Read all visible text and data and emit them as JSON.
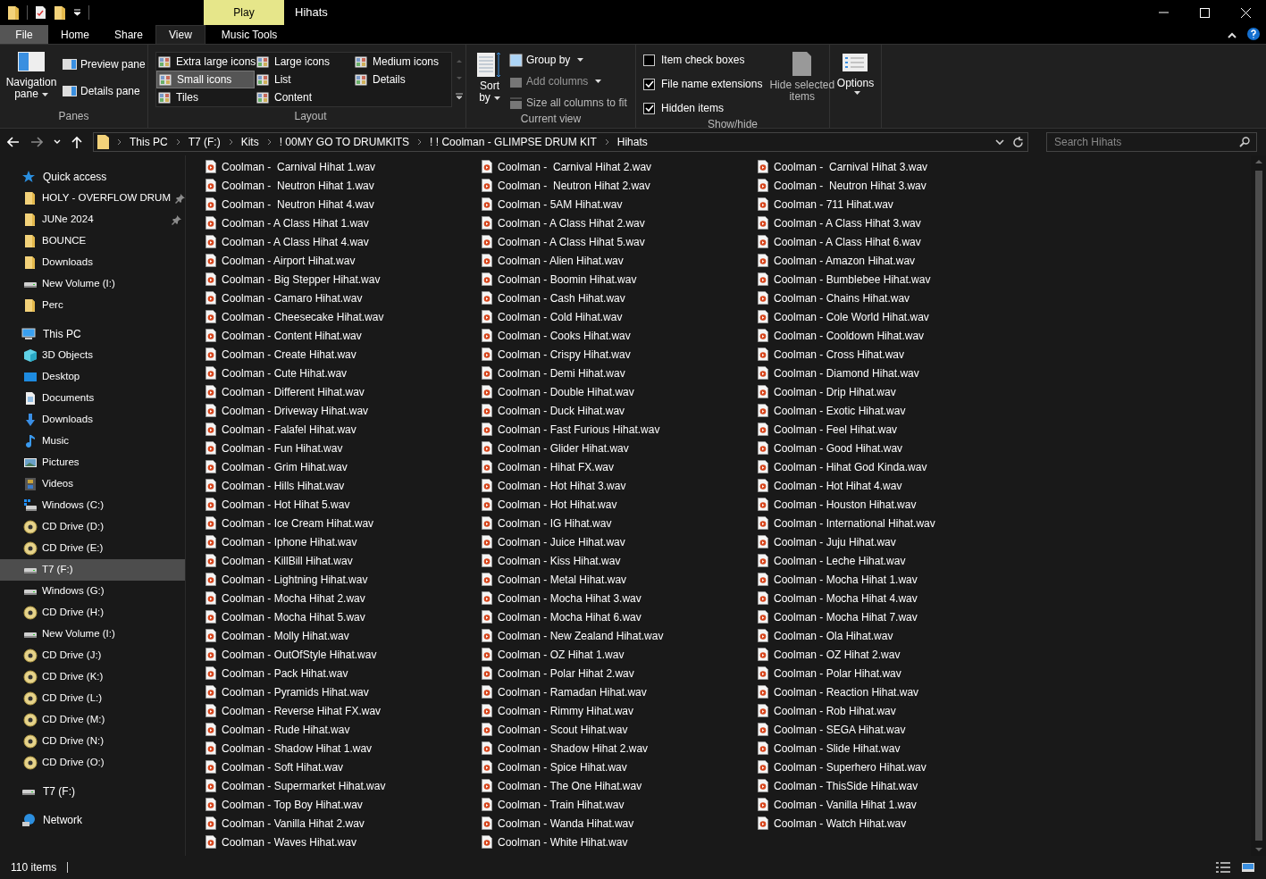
{
  "window": {
    "title": "Hihats",
    "context_tab": "Play"
  },
  "ribbon_tabs": [
    {
      "label": "File",
      "kind": "file",
      "selected": false
    },
    {
      "label": "Home",
      "kind": "tab",
      "selected": false
    },
    {
      "label": "Share",
      "kind": "tab",
      "selected": false
    },
    {
      "label": "View",
      "kind": "tab",
      "selected": true
    },
    {
      "label": "Music Tools",
      "kind": "tab",
      "selected": false
    }
  ],
  "panes": {
    "navigation": "Navigation",
    "navigation_2": "pane",
    "preview": "Preview pane",
    "details": "Details pane",
    "group": "Panes"
  },
  "layout": {
    "items": [
      {
        "label": "Extra large icons",
        "selected": false
      },
      {
        "label": "Large icons",
        "selected": false
      },
      {
        "label": "Medium icons",
        "selected": false
      },
      {
        "label": "Small icons",
        "selected": true
      },
      {
        "label": "List",
        "selected": false
      },
      {
        "label": "Details",
        "selected": false
      },
      {
        "label": "Tiles",
        "selected": false
      },
      {
        "label": "Content",
        "selected": false
      }
    ],
    "group": "Layout"
  },
  "current_view": {
    "sort": "Sort",
    "sort_2": "by",
    "group_by": "Group by",
    "add_columns": "Add columns",
    "size_columns": "Size all columns to fit",
    "group": "Current view"
  },
  "show_hide": {
    "checkboxes": [
      {
        "label": "Item check boxes",
        "checked": false
      },
      {
        "label": "File name extensions",
        "checked": true
      },
      {
        "label": "Hidden items",
        "checked": true
      }
    ],
    "hide_selected": "Hide selected",
    "hide_selected_2": "items",
    "group": "Show/hide"
  },
  "options": {
    "label": "Options"
  },
  "address": {
    "crumbs": [
      "This PC",
      "T7 (F:)",
      "Kits",
      "! 00MY GO TO DRUMKITS",
      "! ! Coolman - GLIMPSE DRUM KIT",
      "Hihats"
    ]
  },
  "search": {
    "placeholder": "Search Hihats"
  },
  "sidebar": [
    {
      "label": "Quick access",
      "kind": "star",
      "selected": false,
      "children": [
        {
          "label": "HOLY - OVERFLOW DRUM",
          "kind": "folder",
          "pinned": true,
          "selected": false
        },
        {
          "label": "JUNe 2024",
          "kind": "folder",
          "pinned": true,
          "selected": false
        },
        {
          "label": "BOUNCE",
          "kind": "folder",
          "pinned": false,
          "selected": false
        },
        {
          "label": "Downloads",
          "kind": "folder",
          "pinned": false,
          "selected": false
        },
        {
          "label": "New Volume (I:)",
          "kind": "drive",
          "pinned": false,
          "selected": false
        },
        {
          "label": "Perc",
          "kind": "folder",
          "pinned": false,
          "selected": false
        }
      ]
    },
    {
      "label": "This PC",
      "kind": "pc",
      "selected": false,
      "children": [
        {
          "label": "3D Objects",
          "kind": "cube",
          "selected": false
        },
        {
          "label": "Desktop",
          "kind": "desktop",
          "selected": false
        },
        {
          "label": "Documents",
          "kind": "docs",
          "selected": false
        },
        {
          "label": "Downloads",
          "kind": "download",
          "selected": false
        },
        {
          "label": "Music",
          "kind": "music",
          "selected": false
        },
        {
          "label": "Pictures",
          "kind": "pictures",
          "selected": false
        },
        {
          "label": "Videos",
          "kind": "videos",
          "selected": false
        },
        {
          "label": "Windows (C:)",
          "kind": "windrive",
          "selected": false
        },
        {
          "label": "CD Drive (D:)",
          "kind": "cd",
          "selected": false
        },
        {
          "label": "CD Drive (E:)",
          "kind": "cd",
          "selected": false
        },
        {
          "label": "T7 (F:)",
          "kind": "drive",
          "selected": true
        },
        {
          "label": "Windows (G:)",
          "kind": "drive",
          "selected": false
        },
        {
          "label": "CD Drive (H:)",
          "kind": "cd",
          "selected": false
        },
        {
          "label": "New Volume (I:)",
          "kind": "drive",
          "selected": false
        },
        {
          "label": "CD Drive (J:)",
          "kind": "cd",
          "selected": false
        },
        {
          "label": "CD Drive (K:)",
          "kind": "cd",
          "selected": false
        },
        {
          "label": "CD Drive (L:)",
          "kind": "cd",
          "selected": false
        },
        {
          "label": "CD Drive (M:)",
          "kind": "cd",
          "selected": false
        },
        {
          "label": "CD Drive (N:)",
          "kind": "cd",
          "selected": false
        },
        {
          "label": "CD Drive (O:)",
          "kind": "cd",
          "selected": false
        }
      ]
    },
    {
      "label": "T7 (F:)",
      "kind": "drive",
      "selected": false
    },
    {
      "label": "Network",
      "kind": "network",
      "selected": false
    }
  ],
  "files": [
    "Coolman -  Carnival Hihat 1.wav",
    "Coolman -  Carnival Hihat 2.wav",
    "Coolman -  Carnival Hihat 3.wav",
    "Coolman -  Neutron Hihat 1.wav",
    "Coolman -  Neutron Hihat 2.wav",
    "Coolman -  Neutron Hihat 3.wav",
    "Coolman -  Neutron Hihat 4.wav",
    "Coolman - 5AM Hihat.wav",
    "Coolman - 711 Hihat.wav",
    "Coolman - A Class Hihat 1.wav",
    "Coolman - A Class Hihat 2.wav",
    "Coolman - A Class Hihat 3.wav",
    "Coolman - A Class Hihat 4.wav",
    "Coolman - A Class Hihat 5.wav",
    "Coolman - A Class Hihat 6.wav",
    "Coolman - Airport Hihat.wav",
    "Coolman - Alien Hihat.wav",
    "Coolman - Amazon Hihat.wav",
    "Coolman - Big Stepper Hihat.wav",
    "Coolman - Boomin Hihat.wav",
    "Coolman - Bumblebee Hihat.wav",
    "Coolman - Camaro Hihat.wav",
    "Coolman - Cash Hihat.wav",
    "Coolman - Chains Hihat.wav",
    "Coolman - Cheesecake Hihat.wav",
    "Coolman - Cold Hihat.wav",
    "Coolman - Cole World Hihat.wav",
    "Coolman - Content Hihat.wav",
    "Coolman - Cooks Hihat.wav",
    "Coolman - Cooldown Hihat.wav",
    "Coolman - Create Hihat.wav",
    "Coolman - Crispy Hihat.wav",
    "Coolman - Cross Hihat.wav",
    "Coolman - Cute Hihat.wav",
    "Coolman - Demi Hihat.wav",
    "Coolman - Diamond Hihat.wav",
    "Coolman - Different Hihat.wav",
    "Coolman - Double Hihat.wav",
    "Coolman - Drip Hihat.wav",
    "Coolman - Driveway Hihat.wav",
    "Coolman - Duck Hihat.wav",
    "Coolman - Exotic Hihat.wav",
    "Coolman - Falafel Hihat.wav",
    "Coolman - Fast Furious Hihat.wav",
    "Coolman - Feel Hihat.wav",
    "Coolman - Fun Hihat.wav",
    "Coolman - Glider Hihat.wav",
    "Coolman - Good Hihat.wav",
    "Coolman - Grim Hihat.wav",
    "Coolman - Hihat FX.wav",
    "Coolman - Hihat God Kinda.wav",
    "Coolman - Hills Hihat.wav",
    "Coolman - Hot Hihat 3.wav",
    "Coolman - Hot Hihat 4.wav",
    "Coolman - Hot Hihat 5.wav",
    "Coolman - Hot Hihat.wav",
    "Coolman - Houston Hihat.wav",
    "Coolman - Ice Cream Hihat.wav",
    "Coolman - IG Hihat.wav",
    "Coolman - International Hihat.wav",
    "Coolman - Iphone Hihat.wav",
    "Coolman - Juice Hihat.wav",
    "Coolman - Juju Hihat.wav",
    "Coolman - KillBill Hihat.wav",
    "Coolman - Kiss Hihat.wav",
    "Coolman - Leche Hihat.wav",
    "Coolman - Lightning Hihat.wav",
    "Coolman - Metal Hihat.wav",
    "Coolman - Mocha Hihat 1.wav",
    "Coolman - Mocha Hihat 2.wav",
    "Coolman - Mocha Hihat 3.wav",
    "Coolman - Mocha Hihat 4.wav",
    "Coolman - Mocha Hihat 5.wav",
    "Coolman - Mocha Hihat 6.wav",
    "Coolman - Mocha Hihat 7.wav",
    "Coolman - Molly Hihat.wav",
    "Coolman - New Zealand Hihat.wav",
    "Coolman - Ola Hihat.wav",
    "Coolman - OutOfStyle Hihat.wav",
    "Coolman - OZ Hihat 1.wav",
    "Coolman - OZ Hihat 2.wav",
    "Coolman - Pack Hihat.wav",
    "Coolman - Polar Hihat 2.wav",
    "Coolman - Polar Hihat.wav",
    "Coolman - Pyramids Hihat.wav",
    "Coolman - Ramadan Hihat.wav",
    "Coolman - Reaction Hihat.wav",
    "Coolman - Reverse Hihat FX.wav",
    "Coolman - Rimmy Hihat.wav",
    "Coolman - Rob Hihat.wav",
    "Coolman - Rude Hihat.wav",
    "Coolman - Scout Hihat.wav",
    "Coolman - SEGA Hihat.wav",
    "Coolman - Shadow Hihat 1.wav",
    "Coolman - Shadow Hihat 2.wav",
    "Coolman - Slide Hihat.wav",
    "Coolman - Soft Hihat.wav",
    "Coolman - Spice Hihat.wav",
    "Coolman - Superhero Hihat.wav",
    "Coolman - Supermarket Hihat.wav",
    "Coolman - The One Hihat.wav",
    "Coolman - ThisSide Hihat.wav",
    "Coolman - Top Boy Hihat.wav",
    "Coolman - Train Hihat.wav",
    "Coolman - Vanilla Hihat 1.wav",
    "Coolman - Vanilla Hihat 2.wav",
    "Coolman - Wanda Hihat.wav",
    "Coolman - Watch Hihat.wav",
    "Coolman - Waves Hihat.wav",
    "Coolman - White Hihat.wav"
  ],
  "status_bar": {
    "count": "110 items"
  }
}
